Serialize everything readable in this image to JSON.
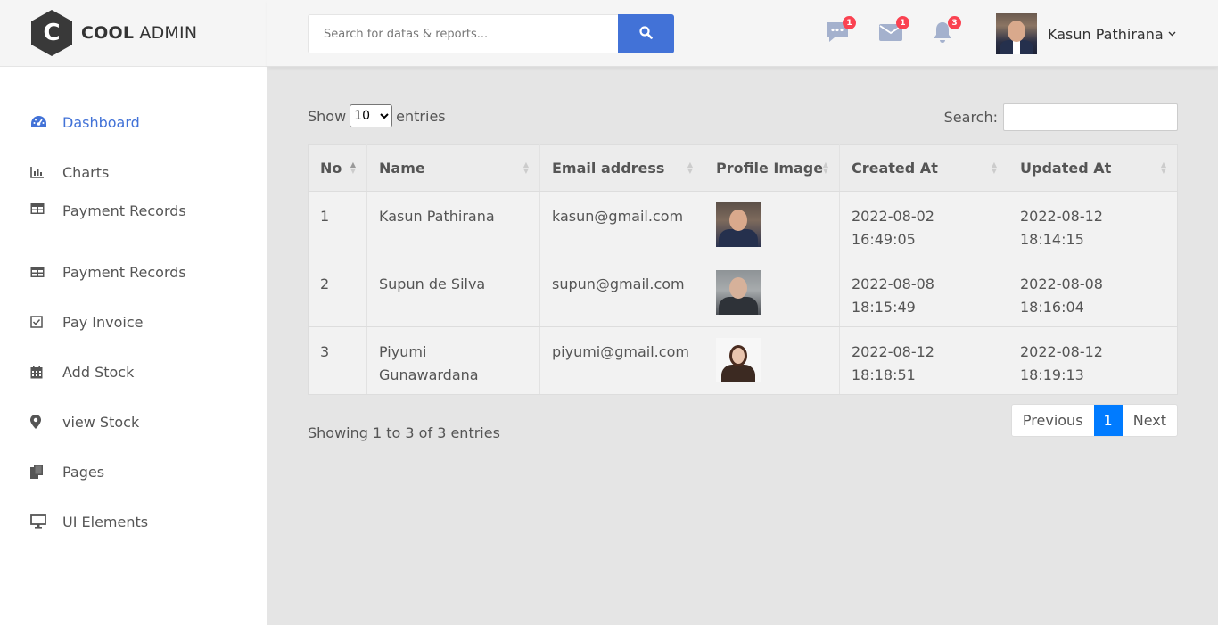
{
  "brand": {
    "logo_letter": "C",
    "name_bold": "COOL",
    "name_rest": "ADMIN"
  },
  "header": {
    "search_placeholder": "Search for datas & reports...",
    "notifications": {
      "chat": "1",
      "mail": "1",
      "bell": "3"
    },
    "user_name": "Kasun Pathirana"
  },
  "sidebar": {
    "items": [
      {
        "label": "Dashboard",
        "icon": "dashboard-icon",
        "active": true
      },
      {
        "label": "Charts",
        "icon": "bar-chart-icon"
      },
      {
        "label": "Payment Records",
        "icon": "table-icon"
      },
      {
        "label": "Payment Records",
        "icon": "table-icon"
      },
      {
        "label": "Pay Invoice",
        "icon": "check-square-icon"
      },
      {
        "label": "Add Stock",
        "icon": "calendar-icon"
      },
      {
        "label": "view Stock",
        "icon": "map-marker-icon"
      },
      {
        "label": "Pages",
        "icon": "copy-icon"
      },
      {
        "label": "UI Elements",
        "icon": "desktop-icon"
      }
    ]
  },
  "table": {
    "show_label": "Show",
    "entries_label": "entries",
    "page_size": "10",
    "search_label": "Search:",
    "columns": [
      "No",
      "Name",
      "Email address",
      "Profile Image",
      "Created At",
      "Updated At"
    ],
    "rows": [
      {
        "no": "1",
        "name": "Kasun Pathirana",
        "email": "kasun@gmail.com",
        "created": "2022-08-02 16:49:05",
        "updated": "2022-08-12 18:14:15"
      },
      {
        "no": "2",
        "name": "Supun de Silva",
        "email": "supun@gmail.com",
        "created": "2022-08-08 18:15:49",
        "updated": "2022-08-08 18:16:04"
      },
      {
        "no": "3",
        "name": "Piyumi Gunawardana",
        "email": "piyumi@gmail.com",
        "created": "2022-08-12 18:18:51",
        "updated": "2022-08-12 18:19:13"
      }
    ],
    "info": "Showing 1 to 3 of 3 entries",
    "pagination": {
      "prev": "Previous",
      "current": "1",
      "next": "Next"
    }
  },
  "colors": {
    "accent": "#4272d7",
    "badge": "#fa4251",
    "page_active": "#007bff"
  }
}
